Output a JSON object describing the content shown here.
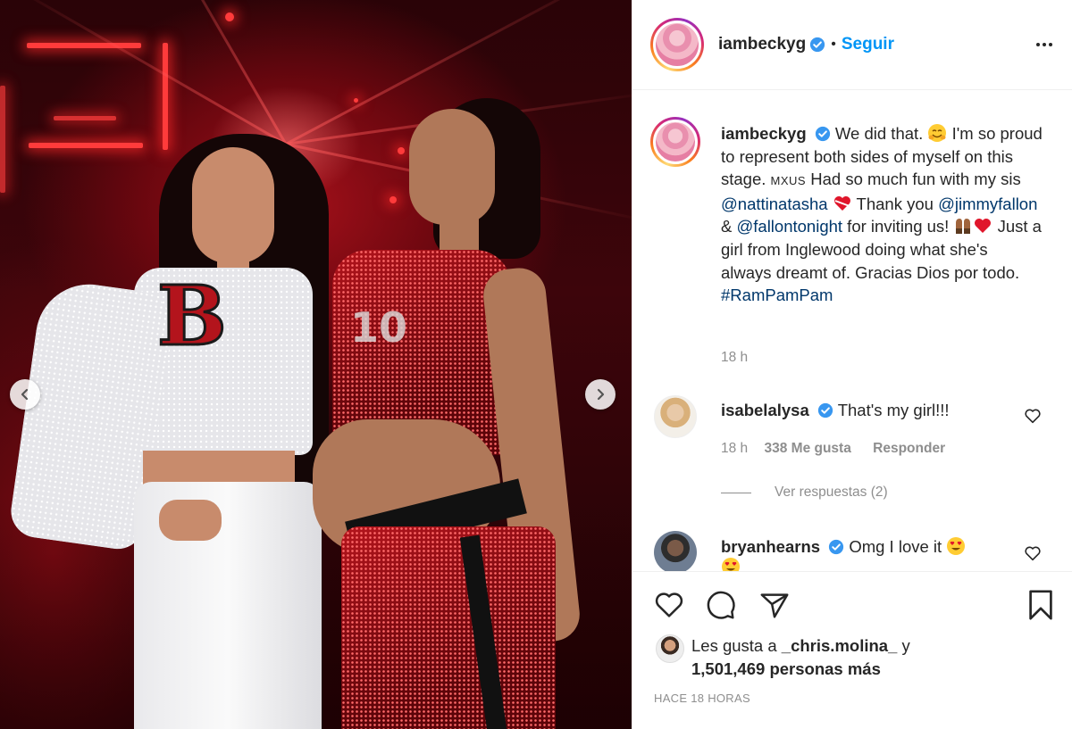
{
  "post": {
    "username": "iambeckyg",
    "follow_label": "Seguir",
    "separator": "•"
  },
  "caption": {
    "username": "iambeckyg",
    "t1": " We did that. ",
    "t2": " I'm so proud to represent both sides of myself on this stage. ",
    "flags": "MXUS",
    "t3": " Had so much fun with my sis ",
    "mention1": "@nattinatasha",
    "t4": " Thank you ",
    "mention2": "@jimmyfallon",
    "t5": " & ",
    "mention3": "@fallontonight",
    "t6": " for inviting us! ",
    "t7": " Just a girl from Inglewood doing what she's always dreamt of. Gracias Dios por todo. ",
    "hashtag": "#RamPamPam",
    "time": "18 h"
  },
  "comments": [
    {
      "username": "isabelalysa",
      "text": " That's my girl!!!",
      "time": "18 h",
      "likes": "338 Me gusta",
      "reply_label": "Responder",
      "view_replies": "Ver respuestas (2)"
    },
    {
      "username": "bryanhearns",
      "text": " Omg I love it "
    }
  ],
  "footer": {
    "likes_prefix": "Les gusta a ",
    "likes_user": "_chris.molina_",
    "likes_and": " y",
    "likes_count": "1,501,469 personas más",
    "time_ago": "HACE 18 HORAS"
  },
  "icons": {
    "like": "heart-icon",
    "comment": "comment-icon",
    "share": "send-icon",
    "save": "bookmark-icon",
    "more": "more-options-icon",
    "prev": "chevron-left-icon",
    "next": "chevron-right-icon"
  },
  "colors": {
    "link": "#00376b",
    "follow": "#0095f6",
    "verified": "#3897f0",
    "muted": "#8e8e8e"
  }
}
